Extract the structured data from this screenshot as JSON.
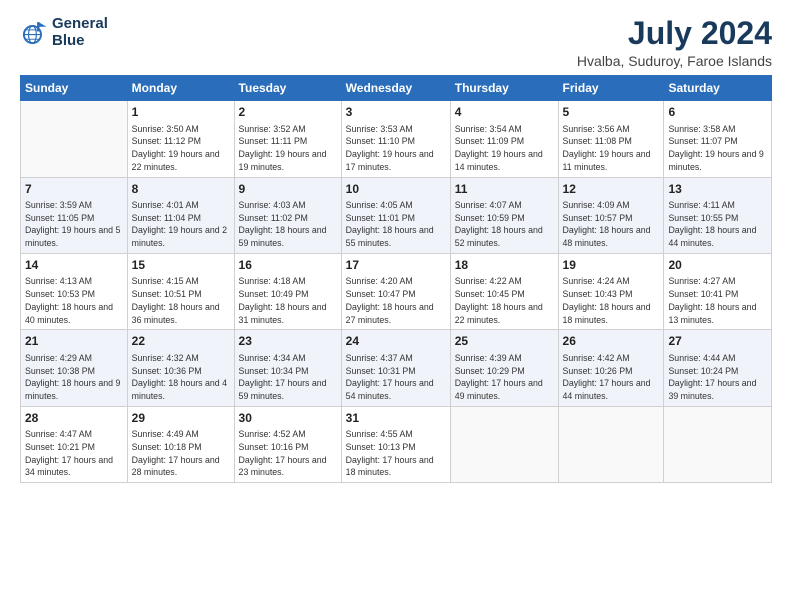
{
  "logo": {
    "line1": "General",
    "line2": "Blue"
  },
  "title": "July 2024",
  "subtitle": "Hvalba, Suduroy, Faroe Islands",
  "header_days": [
    "Sunday",
    "Monday",
    "Tuesday",
    "Wednesday",
    "Thursday",
    "Friday",
    "Saturday"
  ],
  "weeks": [
    [
      {
        "day": null,
        "info": null
      },
      {
        "day": "1",
        "sunrise": "3:50 AM",
        "sunset": "11:12 PM",
        "daylight": "19 hours and 22 minutes."
      },
      {
        "day": "2",
        "sunrise": "3:52 AM",
        "sunset": "11:11 PM",
        "daylight": "19 hours and 19 minutes."
      },
      {
        "day": "3",
        "sunrise": "3:53 AM",
        "sunset": "11:10 PM",
        "daylight": "19 hours and 17 minutes."
      },
      {
        "day": "4",
        "sunrise": "3:54 AM",
        "sunset": "11:09 PM",
        "daylight": "19 hours and 14 minutes."
      },
      {
        "day": "5",
        "sunrise": "3:56 AM",
        "sunset": "11:08 PM",
        "daylight": "19 hours and 11 minutes."
      },
      {
        "day": "6",
        "sunrise": "3:58 AM",
        "sunset": "11:07 PM",
        "daylight": "19 hours and 9 minutes."
      }
    ],
    [
      {
        "day": "7",
        "sunrise": "3:59 AM",
        "sunset": "11:05 PM",
        "daylight": "19 hours and 5 minutes."
      },
      {
        "day": "8",
        "sunrise": "4:01 AM",
        "sunset": "11:04 PM",
        "daylight": "19 hours and 2 minutes."
      },
      {
        "day": "9",
        "sunrise": "4:03 AM",
        "sunset": "11:02 PM",
        "daylight": "18 hours and 59 minutes."
      },
      {
        "day": "10",
        "sunrise": "4:05 AM",
        "sunset": "11:01 PM",
        "daylight": "18 hours and 55 minutes."
      },
      {
        "day": "11",
        "sunrise": "4:07 AM",
        "sunset": "10:59 PM",
        "daylight": "18 hours and 52 minutes."
      },
      {
        "day": "12",
        "sunrise": "4:09 AM",
        "sunset": "10:57 PM",
        "daylight": "18 hours and 48 minutes."
      },
      {
        "day": "13",
        "sunrise": "4:11 AM",
        "sunset": "10:55 PM",
        "daylight": "18 hours and 44 minutes."
      }
    ],
    [
      {
        "day": "14",
        "sunrise": "4:13 AM",
        "sunset": "10:53 PM",
        "daylight": "18 hours and 40 minutes."
      },
      {
        "day": "15",
        "sunrise": "4:15 AM",
        "sunset": "10:51 PM",
        "daylight": "18 hours and 36 minutes."
      },
      {
        "day": "16",
        "sunrise": "4:18 AM",
        "sunset": "10:49 PM",
        "daylight": "18 hours and 31 minutes."
      },
      {
        "day": "17",
        "sunrise": "4:20 AM",
        "sunset": "10:47 PM",
        "daylight": "18 hours and 27 minutes."
      },
      {
        "day": "18",
        "sunrise": "4:22 AM",
        "sunset": "10:45 PM",
        "daylight": "18 hours and 22 minutes."
      },
      {
        "day": "19",
        "sunrise": "4:24 AM",
        "sunset": "10:43 PM",
        "daylight": "18 hours and 18 minutes."
      },
      {
        "day": "20",
        "sunrise": "4:27 AM",
        "sunset": "10:41 PM",
        "daylight": "18 hours and 13 minutes."
      }
    ],
    [
      {
        "day": "21",
        "sunrise": "4:29 AM",
        "sunset": "10:38 PM",
        "daylight": "18 hours and 9 minutes."
      },
      {
        "day": "22",
        "sunrise": "4:32 AM",
        "sunset": "10:36 PM",
        "daylight": "18 hours and 4 minutes."
      },
      {
        "day": "23",
        "sunrise": "4:34 AM",
        "sunset": "10:34 PM",
        "daylight": "17 hours and 59 minutes."
      },
      {
        "day": "24",
        "sunrise": "4:37 AM",
        "sunset": "10:31 PM",
        "daylight": "17 hours and 54 minutes."
      },
      {
        "day": "25",
        "sunrise": "4:39 AM",
        "sunset": "10:29 PM",
        "daylight": "17 hours and 49 minutes."
      },
      {
        "day": "26",
        "sunrise": "4:42 AM",
        "sunset": "10:26 PM",
        "daylight": "17 hours and 44 minutes."
      },
      {
        "day": "27",
        "sunrise": "4:44 AM",
        "sunset": "10:24 PM",
        "daylight": "17 hours and 39 minutes."
      }
    ],
    [
      {
        "day": "28",
        "sunrise": "4:47 AM",
        "sunset": "10:21 PM",
        "daylight": "17 hours and 34 minutes."
      },
      {
        "day": "29",
        "sunrise": "4:49 AM",
        "sunset": "10:18 PM",
        "daylight": "17 hours and 28 minutes."
      },
      {
        "day": "30",
        "sunrise": "4:52 AM",
        "sunset": "10:16 PM",
        "daylight": "17 hours and 23 minutes."
      },
      {
        "day": "31",
        "sunrise": "4:55 AM",
        "sunset": "10:13 PM",
        "daylight": "17 hours and 18 minutes."
      },
      {
        "day": null,
        "info": null
      },
      {
        "day": null,
        "info": null
      },
      {
        "day": null,
        "info": null
      }
    ]
  ],
  "labels": {
    "sunrise": "Sunrise: ",
    "sunset": "Sunset: ",
    "daylight": "Daylight: "
  }
}
